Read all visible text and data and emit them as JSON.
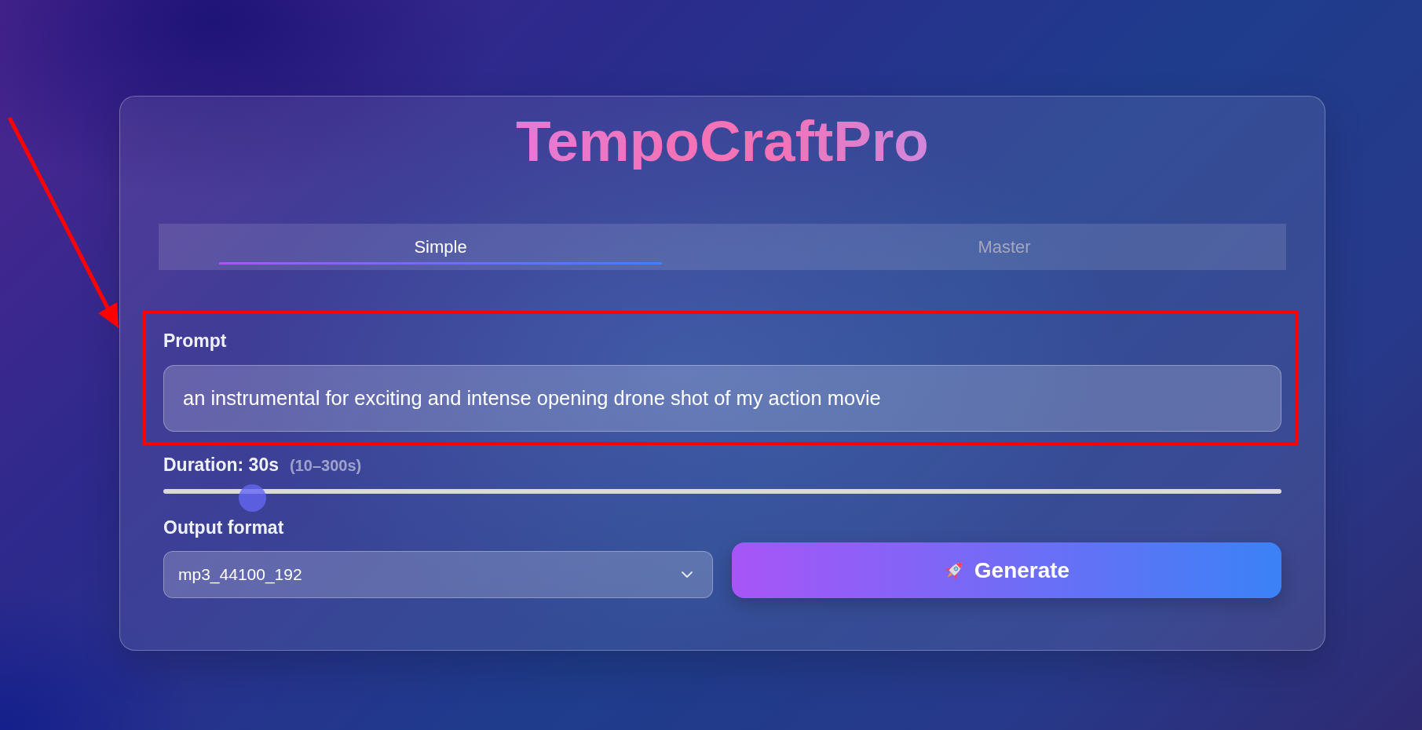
{
  "app": {
    "title": "TempoCraftPro"
  },
  "tabs": [
    {
      "label": "Simple",
      "selected": true
    },
    {
      "label": "Master",
      "selected": false
    }
  ],
  "prompt": {
    "label": "Prompt",
    "value": "an instrumental for exciting and intense opening drone shot of my action movie",
    "highlighted": true
  },
  "duration": {
    "label": "Duration: 30s",
    "range": "(10–300s)",
    "level": 0.069
  },
  "output_format": {
    "label": "Output format",
    "value": "mp3_44100_192"
  },
  "generate_button": {
    "label": "Generate"
  }
}
